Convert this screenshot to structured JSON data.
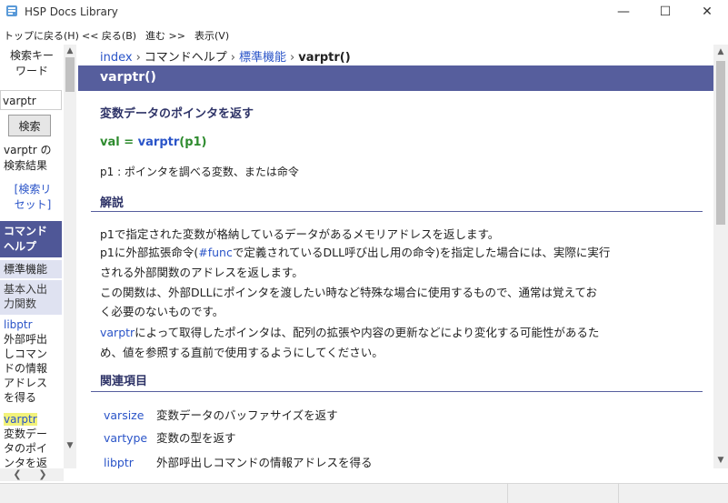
{
  "window": {
    "title": "HSP Docs Library",
    "controls": {
      "minimize": "—",
      "maximize": "☐",
      "close": "✕"
    }
  },
  "menu": {
    "items": [
      "トップに戻る(H)",
      "<< 戻る(B)",
      "進む >>",
      "表示(V)"
    ]
  },
  "sidebar": {
    "heading_1": "検索キー",
    "heading_2": "ワード",
    "search_value": "varptr",
    "search_button": "検索",
    "result_1": "varptr の",
    "result_2": "検索結果",
    "reset_1": "[検索リ",
    "reset_2": "セット]",
    "cmd_help_1": "コマンド",
    "cmd_help_2": "ヘルプ",
    "standard": "標準機能",
    "basic_1": "基本入出",
    "basic_2": "力関数",
    "libptr": {
      "name": "libptr",
      "desc": [
        "外部呼出",
        "しコマン",
        "ドの情報",
        "アドレス",
        "を得る"
      ]
    },
    "varptr": {
      "name": "varptr",
      "desc": [
        "変数デー",
        "タのポイ",
        "ンタを返"
      ]
    }
  },
  "main": {
    "breadcrumb": {
      "index": "index",
      "cmd_help": "コマンドヘルプ",
      "standard": "標準機能",
      "current": "varptr()",
      "sep": "›"
    },
    "title": "varptr()",
    "summary": "変数データのポインタを返す",
    "syntax": {
      "lhs": "val = ",
      "fn": "varptr",
      "args": "(p1)"
    },
    "param": "p1 : ポインタを調べる変数、または命令",
    "explanation_heading": "解説",
    "description": {
      "line1": "p1で指定された変数が格納しているデータがあるメモリアドレスを返します。",
      "line2_a": "p1に外部拡張命令(",
      "line2_link": "#func",
      "line2_b": "で定義されているDLL呼び出し用の命令)を指定した場合には、実際に実行",
      "line3": "される外部関数のアドレスを返します。",
      "line4": "この関数は、外部DLLにポインタを渡したい時など特殊な場合に使用するもので、通常は覚えてお",
      "line5": "く必要のないものです。",
      "line6_link": "varptr",
      "line6_b": "によって取得したポインタは、配列の拡張や内容の更新などにより変化する可能性があるた",
      "line7": "め、値を参照する直前で使用するようにしてください。"
    },
    "related_heading": "関連項目",
    "related": [
      {
        "name": "varsize",
        "desc": "変数データのバッファサイズを返す"
      },
      {
        "name": "vartype",
        "desc": "変数の型を返す"
      },
      {
        "name": "libptr",
        "desc": "外部呼出しコマンドの情報アドレスを得る"
      }
    ]
  },
  "colors": {
    "title_bar": "#565e9d",
    "sidebar_active": "#4f5797",
    "link": "#2a54c8",
    "syntax_green": "#2e8b2e",
    "highlight": "#f2f27a"
  },
  "icons": {
    "scroll_up": "▲",
    "scroll_down": "▼",
    "scroll_left": "❮",
    "scroll_right": "❯"
  }
}
